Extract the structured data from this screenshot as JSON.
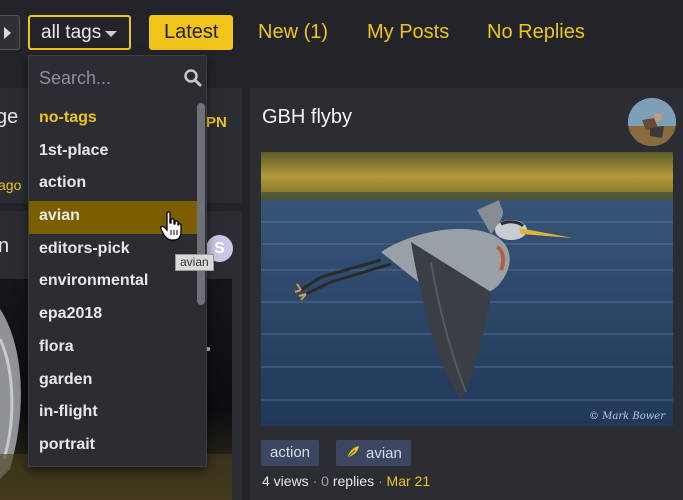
{
  "nav": {
    "tag_select": "all tags",
    "items": [
      {
        "label": "Latest",
        "active": true
      },
      {
        "label": "New (1)",
        "active": false
      },
      {
        "label": "My Posts",
        "active": false
      },
      {
        "label": "No Replies",
        "active": false
      }
    ]
  },
  "dropdown": {
    "search_placeholder": "Search...",
    "tags": [
      "no-tags",
      "1st-place",
      "action",
      "avian",
      "editors-pick",
      "environmental",
      "epa2018",
      "flora",
      "garden",
      "in-flight",
      "portrait"
    ],
    "hovered": "avian",
    "tooltip": "avian"
  },
  "left_cards": {
    "top_title_fragment": "ge",
    "top_badge": "PN",
    "top_meta": "ago",
    "bottom_title_fragment": "n",
    "bottom_avatar_letter": "S"
  },
  "topic": {
    "title": "GBH flyby",
    "tags": [
      "action",
      "avian"
    ],
    "views": "4 views",
    "sep1": "·",
    "replies_count": "0",
    "replies_label": "replies",
    "sep2": "·",
    "date": "Mar 21",
    "watermark": "© Mark Bower"
  },
  "colors": {
    "accent": "#f0c419",
    "background": "#222429",
    "card": "#2b2d33",
    "hover": "#7a5e00",
    "chip": "#3c4660"
  }
}
